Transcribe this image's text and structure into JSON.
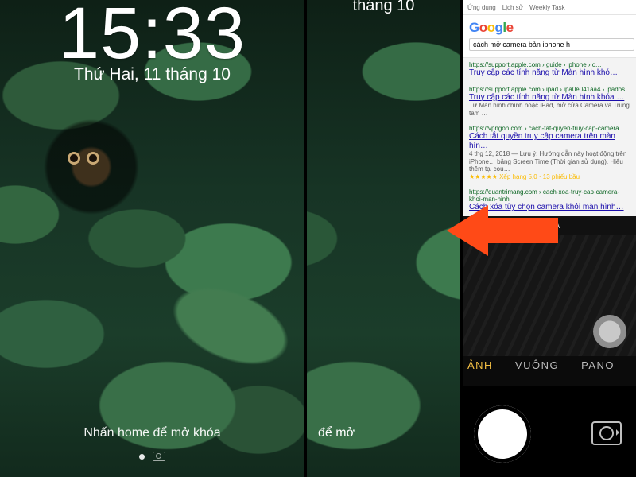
{
  "lockscreen": {
    "time": "15:33",
    "date": "Thứ Hai, 11 tháng 10",
    "unlock_hint": "Nhấn home để mở khóa",
    "page_indicator_glyph": "camera-icon"
  },
  "lockscreen_partial": {
    "date_fragment": "tháng 10",
    "unlock_fragment": "để mở"
  },
  "camera_app": {
    "viewfinder_browser": {
      "tabs": [
        "Ứng dụng",
        "Lịch sử",
        "Weekly Task"
      ],
      "logo_text": "Google",
      "search_query": "cách mở camera bản iphone h",
      "results": [
        {
          "url": "https://support.apple.com › guide › iphone › c…",
          "title": "Truy cập các tính năng từ Màn hình khó…",
          "snippet": ""
        },
        {
          "url": "https://support.apple.com › ipad › ipa0e041aa4 › ipados",
          "title": "Truy cập các tính năng từ Màn hình khóa …",
          "snippet": "Từ Màn hình chính hoặc iPad, mở cửa Camera và Trung tâm …"
        },
        {
          "url": "https://vpngon.com › cach-tat-quyen-truy-cap-camera",
          "title": "Cách tắt quyền truy cập camera trên màn hìn…",
          "snippet": "4 thg 12, 2018 — Lưu ý: Hướng dẫn này hoạt động trên iPhone… bằng Screen Time (Thời gian sử dụng). Hiểu thêm tại cou…",
          "rating": "★★★★★ Xếp hạng 5,0 · 13 phiếu bầu"
        },
        {
          "url": "https://quantrimang.com › cach-xoa-truy-cap-camera-khoi-man-hinh",
          "title": "Cách xóa tùy chọn camera khỏi màn hình…",
          "snippet": ""
        }
      ]
    },
    "focus_label": "KHÓA",
    "modes": {
      "items": [
        "ẢNH",
        "VUÔNG",
        "PANO"
      ],
      "active_index": 0
    },
    "shutter_name": "shutter-button",
    "flip_name": "flip-camera-button",
    "mini_shutter_name": "mini-shutter"
  },
  "annotation": {
    "arrow_color": "#ff4a17",
    "direction": "left"
  }
}
